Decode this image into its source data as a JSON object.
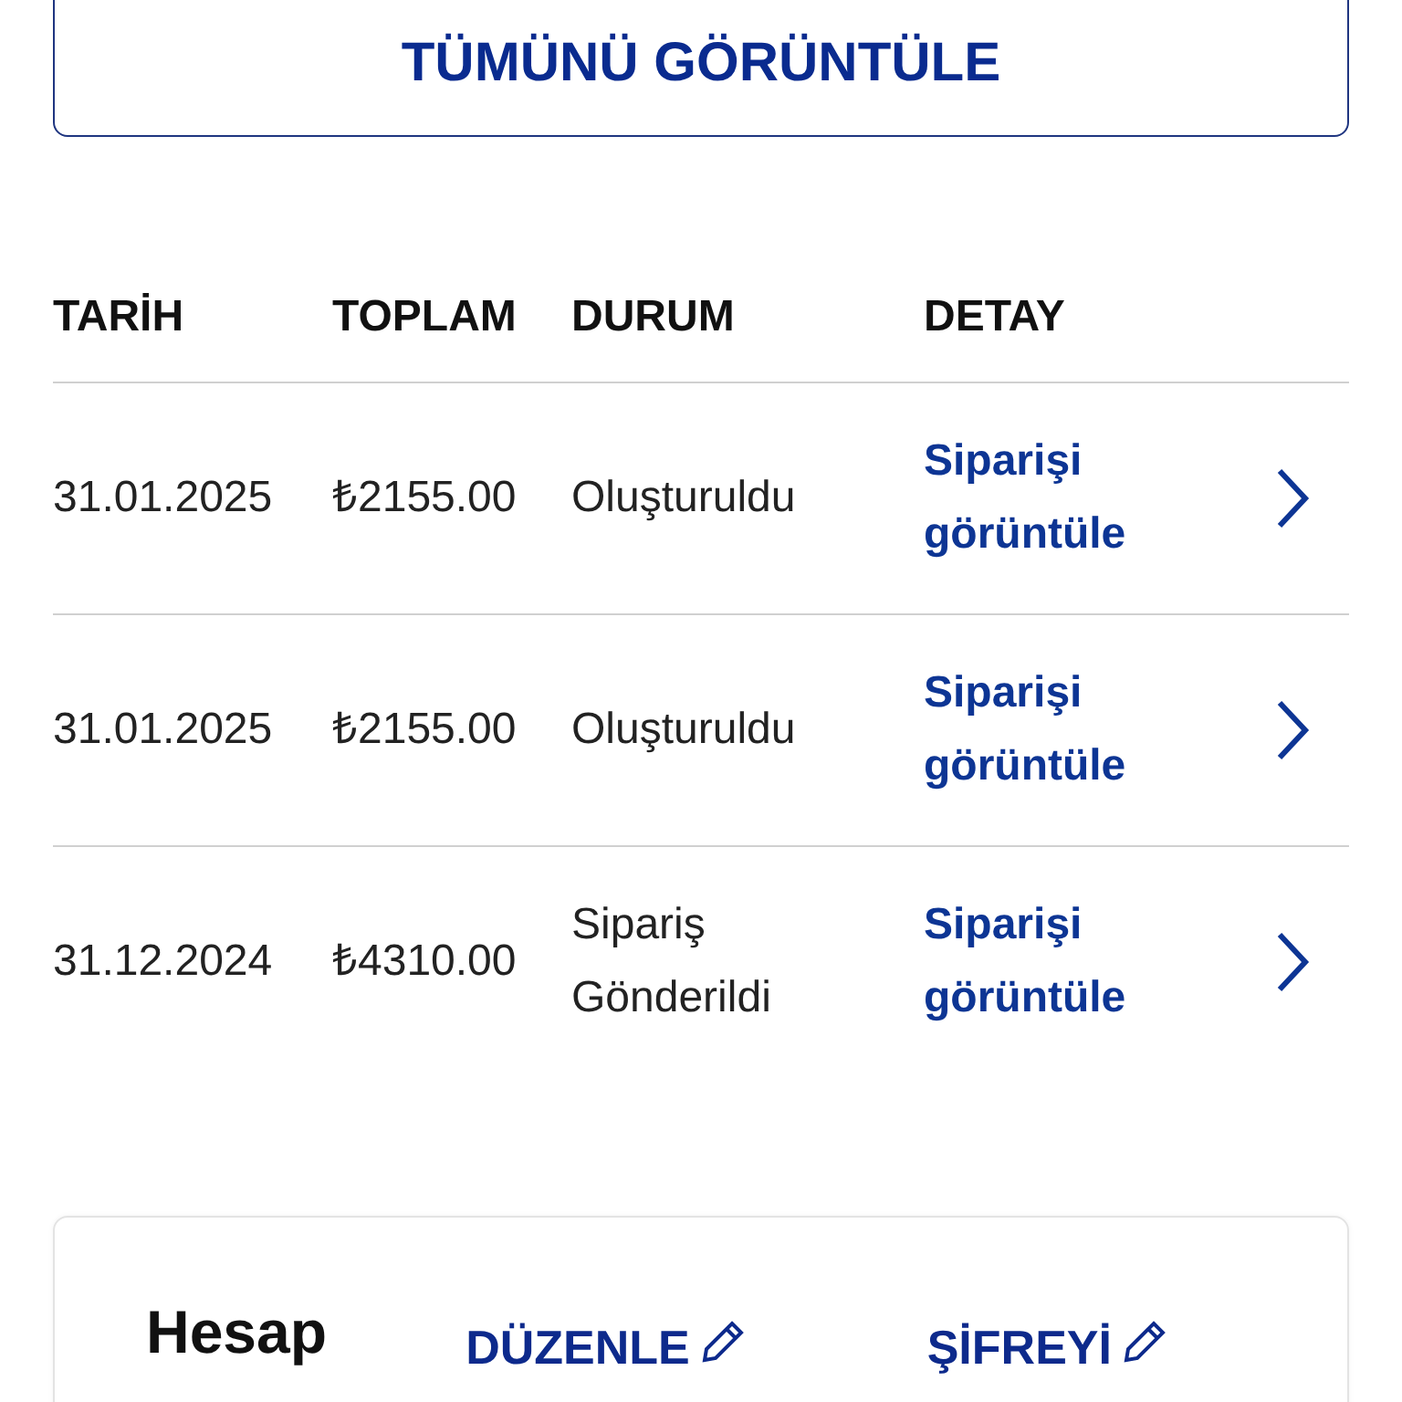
{
  "view_all_button": "TÜMÜNÜ GÖRÜNTÜLE",
  "orders_table": {
    "columns": [
      "TARİH",
      "TOPLAM",
      "DURUM",
      "DETAY"
    ],
    "rows": [
      {
        "date": "31.01.2025",
        "total": "₺2155.00",
        "status": "Oluşturuldu",
        "detail_link": "Siparişi görüntüle"
      },
      {
        "date": "31.01.2025",
        "total": "₺2155.00",
        "status": "Oluşturuldu",
        "detail_link": "Siparişi görüntüle"
      },
      {
        "date": "31.12.2024",
        "total": "₺4310.00",
        "status": "Sipariş Gönderildi",
        "detail_link": "Siparişi görüntüle"
      }
    ]
  },
  "account_card": {
    "title": "Hesap",
    "edit_link": "DÜZENLE",
    "password_link": "ŞİFREYİ"
  }
}
